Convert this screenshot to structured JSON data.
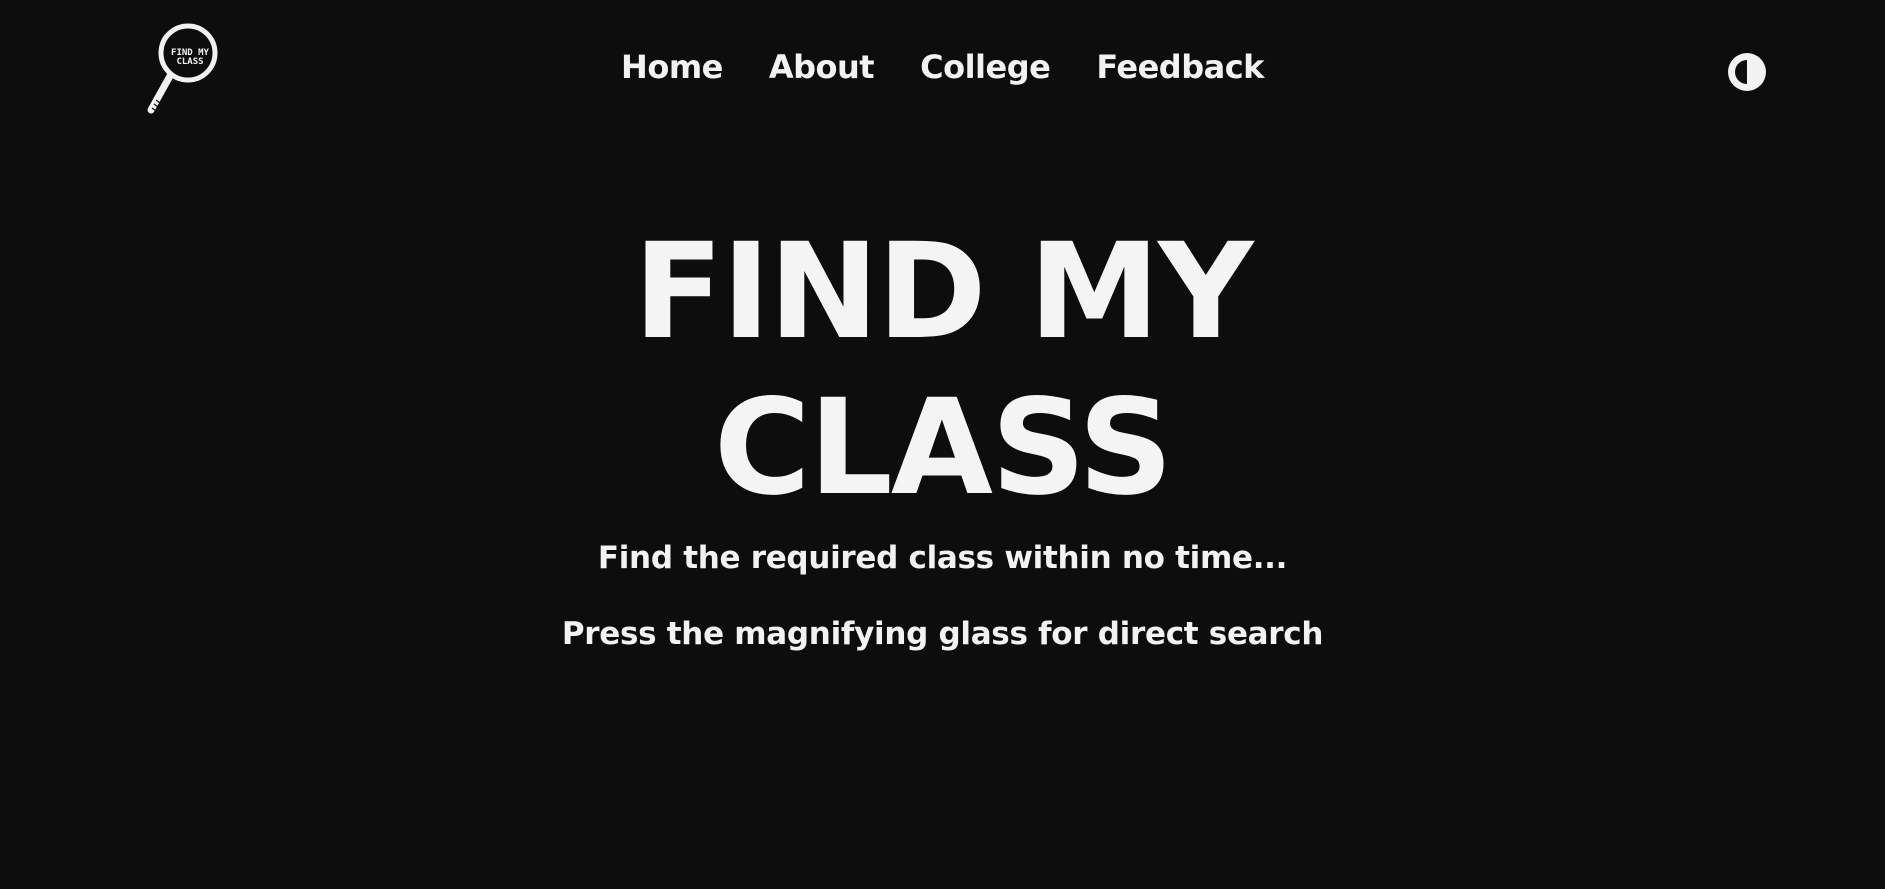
{
  "header": {
    "logo": {
      "text_line1": "FIND MY",
      "text_line2": "CLASS",
      "icon": "magnifying-glass-icon"
    },
    "nav": [
      {
        "label": "Home"
      },
      {
        "label": "About"
      },
      {
        "label": "College"
      },
      {
        "label": "Feedback"
      }
    ],
    "theme_toggle_icon": "contrast-icon"
  },
  "hero": {
    "title_line1": "FIND MY",
    "title_line2": "CLASS",
    "tagline": "Find the required class within no time...",
    "instruction": "Press the magnifying glass for direct search"
  },
  "colors": {
    "background": "#0d0d0d",
    "text": "#f2f2f2"
  }
}
